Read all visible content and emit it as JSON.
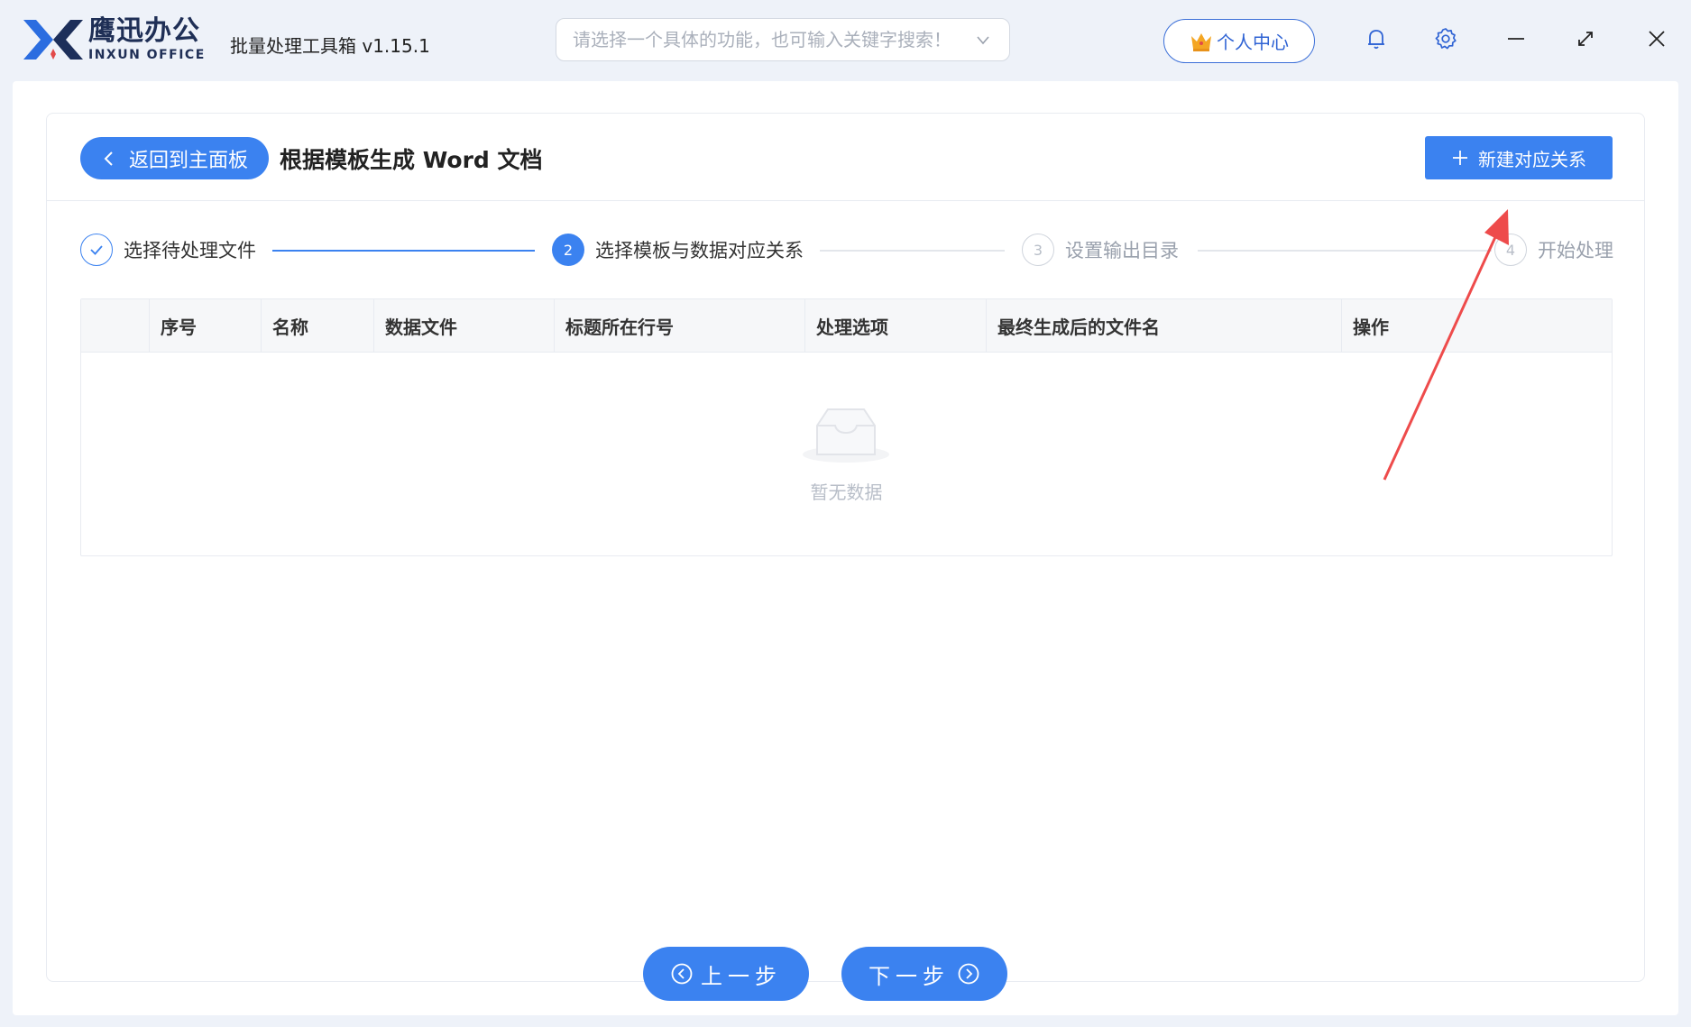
{
  "app": {
    "logo_cn": "鹰迅办公",
    "logo_en": "INXUN OFFICE",
    "title": "批量处理工具箱 v1.15.1"
  },
  "search": {
    "placeholder": "请选择一个具体的功能，也可输入关键字搜索！",
    "value": ""
  },
  "header": {
    "user_center_label": "个人中心",
    "icons": [
      "crown-icon",
      "bell-icon",
      "gear-icon",
      "minimize-icon",
      "maximize-icon",
      "close-icon"
    ]
  },
  "toolbar": {
    "back_label": "返回到主面板",
    "page_title": "根据模板生成 Word 文档",
    "new_label": "新建对应关系"
  },
  "steps": [
    {
      "number": "1",
      "label": "选择待处理文件",
      "state": "done"
    },
    {
      "number": "2",
      "label": "选择模板与数据对应关系",
      "state": "active"
    },
    {
      "number": "3",
      "label": "设置输出目录",
      "state": "todo"
    },
    {
      "number": "4",
      "label": "开始处理",
      "state": "todo"
    }
  ],
  "table": {
    "columns": [
      "序号",
      "名称",
      "数据文件",
      "标题所在行号",
      "处理选项",
      "最终生成后的文件名",
      "操作"
    ],
    "rows": [],
    "empty_text": "暂无数据"
  },
  "footer": {
    "prev_label": "上一步",
    "next_label": "下一步"
  },
  "colors": {
    "accent": "#3b82f0",
    "annotation_arrow": "#ee4b4b",
    "background": "#eef2f9"
  }
}
